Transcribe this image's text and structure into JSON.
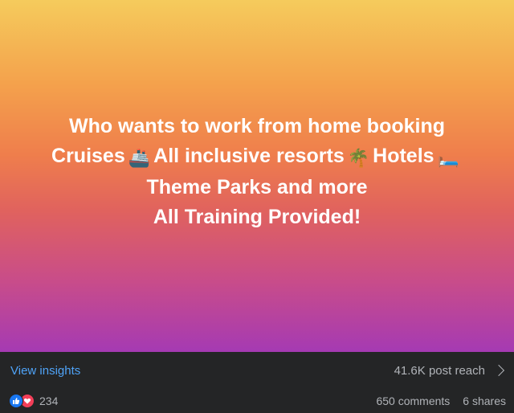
{
  "post": {
    "lines": [
      "Who wants to work from home booking",
      "Cruises",
      "All inclusive resorts",
      "Hotels",
      "Theme Parks and more",
      "All Training Provided!"
    ],
    "emoji_ship": "🚢",
    "emoji_palm": "🌴",
    "emoji_bed": "🛏️"
  },
  "insights": {
    "link_label": "View insights",
    "reach_label": "41.6K post reach"
  },
  "stats": {
    "reactions_count": "234",
    "comments": "650 comments",
    "shares": "6 shares"
  },
  "colors": {
    "gradient_top": "#f5cb5c",
    "gradient_bottom": "#a53ab3",
    "link": "#4fa3f7",
    "like": "#1877f2",
    "love": "#f33e58"
  },
  "icons": [
    "ship-emoji",
    "palm-tree-emoji",
    "bed-emoji",
    "chevron-right-icon",
    "like-icon",
    "love-icon"
  ]
}
